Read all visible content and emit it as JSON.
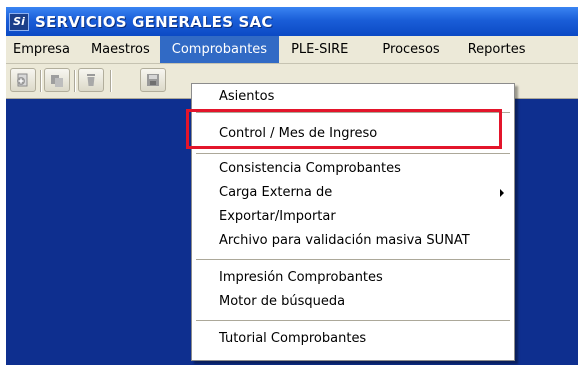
{
  "window": {
    "app_logo": "Si",
    "title": "SERVICIOS GENERALES SAC"
  },
  "menubar": {
    "items": [
      "Empresa",
      "Maestros",
      "Comprobantes",
      "PLE-SIRE",
      "Procesos",
      "Reportes"
    ],
    "active": "Comprobantes"
  },
  "toolbar": {
    "buttons": [
      "new-icon",
      "copy-icon",
      "delete-icon",
      "save-icon"
    ]
  },
  "dropdown": {
    "items": [
      "Asientos",
      "Control / Mes de Ingreso",
      "Consistencia Comprobantes",
      "Carga Externa de",
      "Exportar/Importar",
      "Archivo para validación masiva SUNAT",
      "Impresión Comprobantes",
      "Motor de búsqueda",
      "Tutorial Comprobantes"
    ],
    "highlighted_item": "Control / Mes de Ingreso",
    "highlight_color": "#e3152b"
  },
  "colors": {
    "titlebar": "#1a5ed8",
    "menu_active": "#316ac5",
    "workspace": "#0e2f8f",
    "chrome": "#ece9d8"
  }
}
